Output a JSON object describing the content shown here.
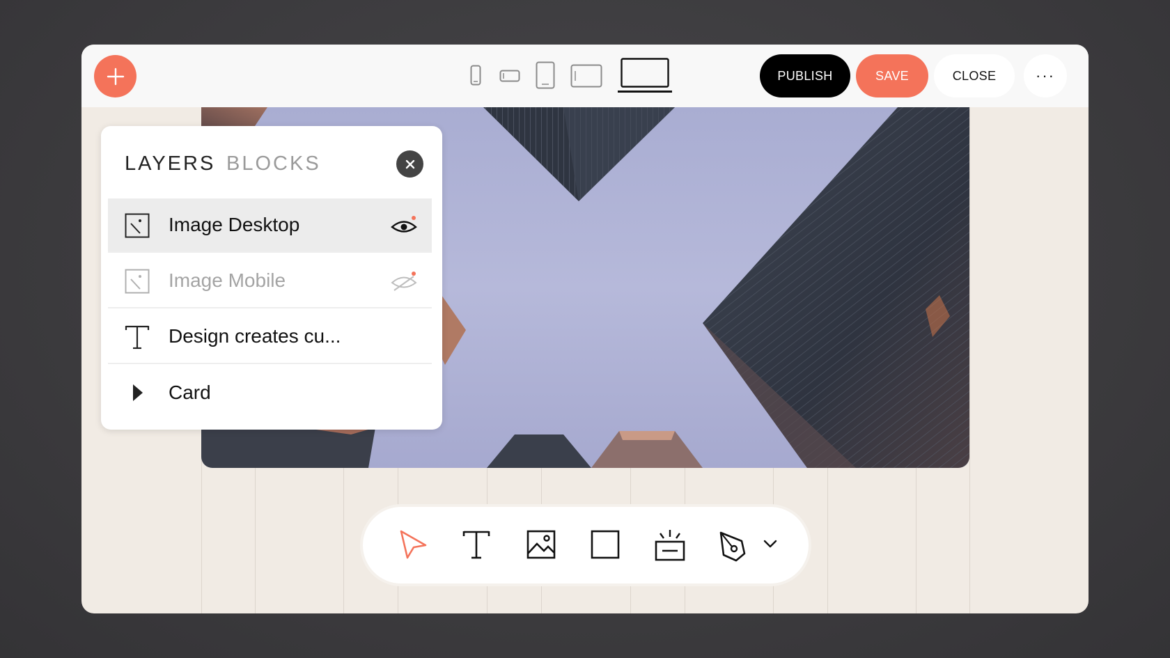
{
  "topbar": {
    "add_label": "+",
    "device_sizes": [
      "mobile-portrait",
      "mobile-landscape",
      "tablet-portrait",
      "tablet-landscape",
      "desktop"
    ],
    "active_device": "desktop",
    "publish_label": "PUBLISH",
    "save_label": "SAVE",
    "close_label": "CLOSE",
    "more_label": "···"
  },
  "panel": {
    "tabs": [
      {
        "label": "LAYERS",
        "active": true
      },
      {
        "label": "BLOCKS",
        "active": false
      }
    ],
    "close_icon": "close-icon",
    "layers": [
      {
        "label": "Image Desktop",
        "icon": "image-icon",
        "visible": true,
        "selected": true
      },
      {
        "label": "Image Mobile",
        "icon": "image-icon",
        "visible": false,
        "selected": false
      },
      {
        "label": "Design creates cu...",
        "icon": "text-icon",
        "selected": false
      },
      {
        "label": "Card",
        "icon": "expand-triangle-icon",
        "selected": false
      }
    ]
  },
  "toolbar": {
    "tools": [
      "pointer-icon",
      "text-tool-icon",
      "image-tool-icon",
      "rectangle-tool-icon",
      "spotlight-tool-icon",
      "pen-tool-icon",
      "chevron-down-icon"
    ],
    "active_tool": "pointer-icon"
  },
  "colors": {
    "accent": "#f4735a",
    "canvas": "#f1ebe4",
    "publish": "#000000"
  }
}
